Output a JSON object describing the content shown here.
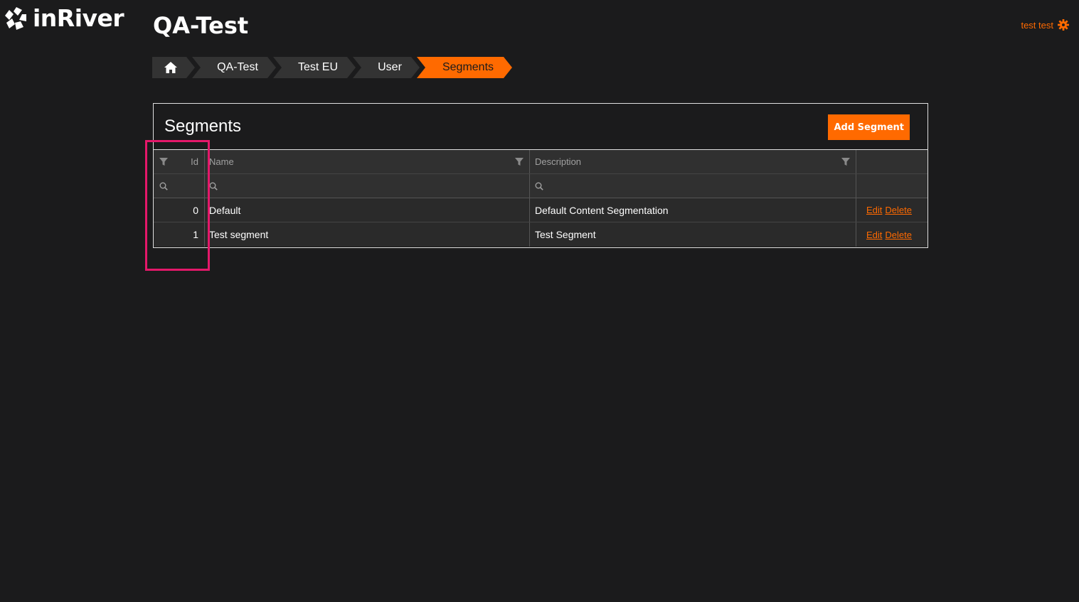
{
  "brand": {
    "logo_text": "inRiver",
    "accent_color": "#ff6a00",
    "icon": "inriver-logo-icon"
  },
  "page": {
    "title": "QA-Test"
  },
  "user_menu": {
    "label": "test test",
    "icon": "gear-icon"
  },
  "breadcrumb": {
    "home_icon": "home-icon",
    "items": [
      {
        "label": "QA-Test"
      },
      {
        "label": "Test EU"
      },
      {
        "label": "User"
      },
      {
        "label": "Segments",
        "active": true
      }
    ]
  },
  "panel": {
    "title": "Segments",
    "add_button_label": "Add Segment"
  },
  "grid": {
    "columns": [
      {
        "label": "Id",
        "filterable": true
      },
      {
        "label": "Name",
        "filterable": true
      },
      {
        "label": "Description",
        "filterable": true
      },
      {
        "label": ""
      }
    ],
    "rows": [
      {
        "id": "0",
        "name": "Default",
        "description": "Default Content Segmentation",
        "edit_label": "Edit",
        "delete_label": "Delete"
      },
      {
        "id": "1",
        "name": "Test segment",
        "description": "Test Segment",
        "edit_label": "Edit",
        "delete_label": "Delete"
      }
    ]
  },
  "highlight": {
    "color": "#e4186a"
  }
}
